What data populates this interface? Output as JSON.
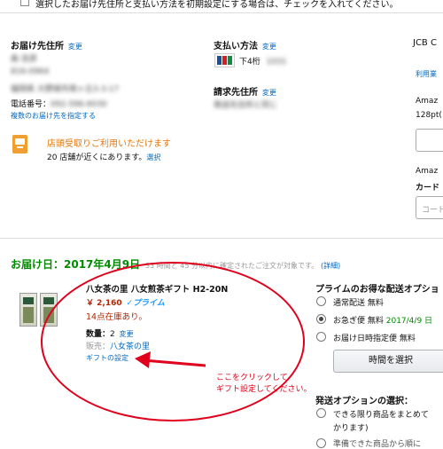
{
  "top": {
    "checkbox_text": "選択したお届け先住所と支払い方法を初期設定にする場合は、チェックを入れてください。"
  },
  "shipping_address": {
    "heading": "お届け先住所",
    "change": "変更",
    "name": "森 信彦",
    "postal": "816-0964",
    "address1": "福岡県 大野城市南ヶ丘3-3-17",
    "address2": "福岡県",
    "phone_label": "電話番号：",
    "phone": "092-596-6030",
    "multi_link": "複数のお届け先を指定する"
  },
  "pickup": {
    "title": "店頭受取りご利用いただけます",
    "count_text": "20 店舗が近くにあります。",
    "select_link": "選択"
  },
  "payment": {
    "heading": "支払い方法",
    "change": "変更",
    "card_last4_label": "下4桁",
    "card_last4": "1031"
  },
  "billing": {
    "heading": "請求先住所",
    "change": "変更",
    "value": "発送先住所と同じ"
  },
  "right_column": {
    "jcb": "JCB C",
    "riyou_link": "利用業",
    "amazon1": "Amaz",
    "points": "128pt(",
    "amazon2": "Amaz",
    "card_label": "カード",
    "code_placeholder": "コード"
  },
  "delivery": {
    "date_label": "お届け日：2017年4月9日",
    "timer_text": "33 時間と 45 分以内に確定されたご注文が対象です。",
    "detail_link": "(詳細)"
  },
  "item": {
    "title": "八女茶の里 八女煎茶ギフト H2-20N",
    "price": "￥ 2,160",
    "prime_label": "✓プライム",
    "stock": "14点在庫あり。",
    "qty_label": "数量：",
    "qty": "2",
    "qty_change": "変更",
    "seller_label": "販売：",
    "seller": "八女茶の里",
    "gift_link": "ギフトの設定"
  },
  "annotation": {
    "line1": "ここをクリックして",
    "line2": "ギフト設定してください。",
    "color": "#e0001b"
  },
  "prime_options": {
    "heading": "プライムのお得な配送オプショ",
    "options": [
      {
        "label": "通常配送 無料",
        "selected": false
      },
      {
        "label": "お急ぎ便 無料",
        "date": "2017/4/9 日",
        "selected": true
      },
      {
        "label": "お届け日時指定便 無料",
        "selected": false
      }
    ],
    "time_button": "時間を選択"
  },
  "ship_options": {
    "heading": "発送オプションの選択：",
    "option1_line1": "できる限り商品をまとめて",
    "option1_line2": "かります)",
    "option2_partial": "準備できた商品から順に"
  }
}
